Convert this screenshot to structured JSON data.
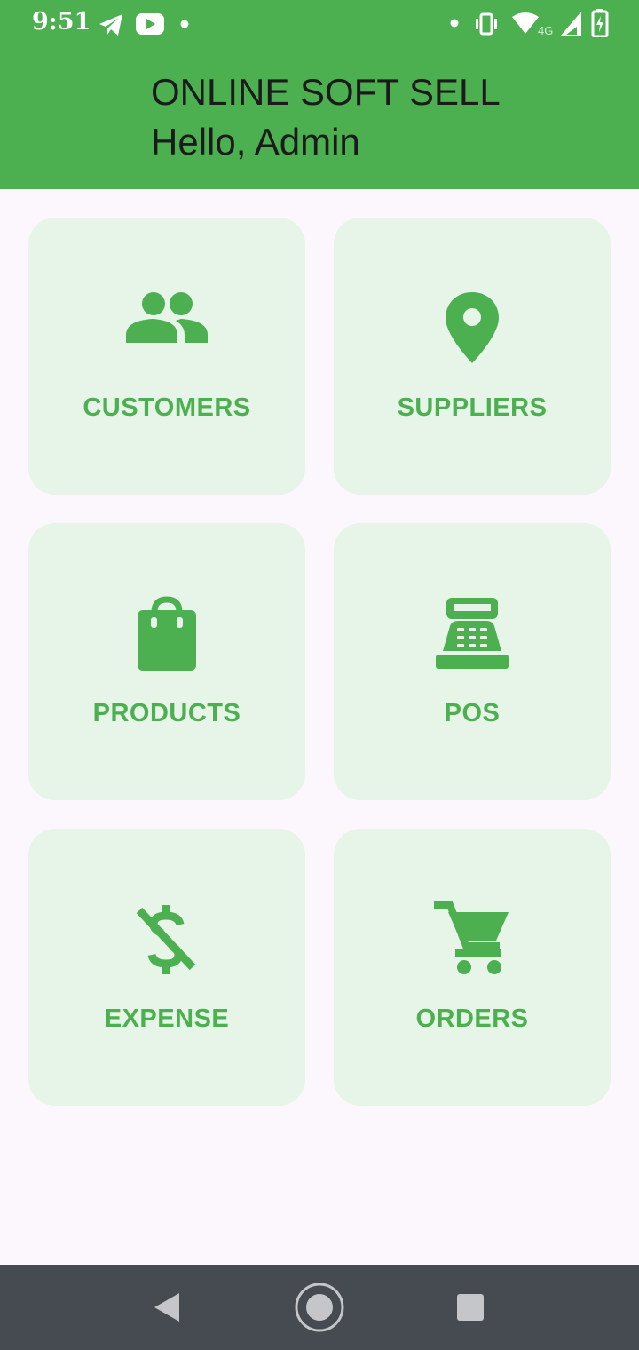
{
  "status_bar": {
    "time": "9:51",
    "network_label": "4G",
    "icons": [
      "telegram-icon",
      "youtube-icon",
      "notification-dot-icon",
      "vibrate-icon",
      "wifi-icon",
      "signal-icon",
      "battery-charging-icon"
    ]
  },
  "header": {
    "title": "ONLINE SOFT SELL",
    "greeting": "Hello, Admin"
  },
  "menu": [
    {
      "label": "CUSTOMERS",
      "icon": "people-icon"
    },
    {
      "label": "SUPPLIERS",
      "icon": "location-pin-icon"
    },
    {
      "label": "PRODUCTS",
      "icon": "shopping-bag-icon"
    },
    {
      "label": "POS",
      "icon": "cash-register-icon"
    },
    {
      "label": "EXPENSE",
      "icon": "money-off-icon"
    },
    {
      "label": "ORDERS",
      "icon": "shopping-cart-icon"
    }
  ],
  "nav_bar": {
    "buttons": [
      "back-icon",
      "home-icon",
      "recents-icon"
    ]
  },
  "colors": {
    "primary": "#4caf50",
    "card_background": "#e7f4e8",
    "page_background": "#fcf7fd",
    "nav_bar": "#464b52"
  }
}
